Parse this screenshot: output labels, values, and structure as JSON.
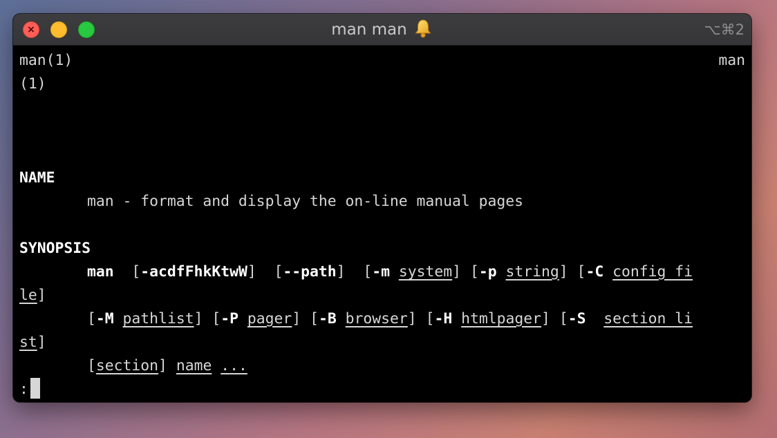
{
  "window": {
    "title": "man man",
    "shortcut": "⌥⌘2",
    "close_glyph": "×"
  },
  "terminal": {
    "header_left": "man(1)",
    "header_right": "man",
    "header_wrap": "(1)",
    "name_heading": "NAME",
    "name_description": "man - format and display the on-line manual pages",
    "synopsis_heading": "SYNOPSIS",
    "line1": {
      "cmd": "man",
      "sp1": "  ",
      "br1": "[",
      "opt1": "-acdfFhkKtwW",
      "br2": "]",
      "sp2": "  ",
      "br3": "[",
      "opt2": "--path",
      "br4": "]",
      "sp3": "  ",
      "br5": "[",
      "opt3": "-m",
      "sp4": " ",
      "arg3": "system",
      "br6": "]",
      "sp5": " ",
      "br7": "[",
      "opt4": "-p",
      "sp6": " ",
      "arg4": "string",
      "br8": "]",
      "sp7": " ",
      "br9": "[",
      "opt5": "-C",
      "sp8": " ",
      "arg5": "config_fi"
    },
    "line2": {
      "arg5_cont": "le",
      "br": "]"
    },
    "line3": {
      "br1": "[",
      "opt1": "-M",
      "sp1": " ",
      "arg1": "pathlist",
      "br2": "]",
      "sp2": " ",
      "br3": "[",
      "opt2": "-P",
      "sp3": " ",
      "arg2": "pager",
      "br4": "]",
      "sp4": " ",
      "br5": "[",
      "opt3": "-B",
      "sp5": " ",
      "arg3": "browser",
      "br6": "]",
      "sp6": " ",
      "br7": "[",
      "opt4": "-H",
      "sp7": " ",
      "arg4": "htmlpager",
      "br8": "]",
      "sp8": " ",
      "br9": "[",
      "opt5": "-S",
      "sp9": "  ",
      "arg5": "section_li"
    },
    "line4": {
      "arg5_cont": "st",
      "br": "]"
    },
    "line5": {
      "br1": "[",
      "arg1": "section",
      "br2": "]",
      "sp1": " ",
      "arg2": "name",
      "sp2": " ",
      "arg3": "..."
    },
    "prompt": ":"
  },
  "colors": {
    "close": "#ff5f57",
    "minimize": "#febc2e",
    "maximize": "#28c840",
    "terminal_bg": "#000000",
    "terminal_fg": "#d7d7d7"
  },
  "icons": {
    "title_icon": "bell-icon"
  }
}
